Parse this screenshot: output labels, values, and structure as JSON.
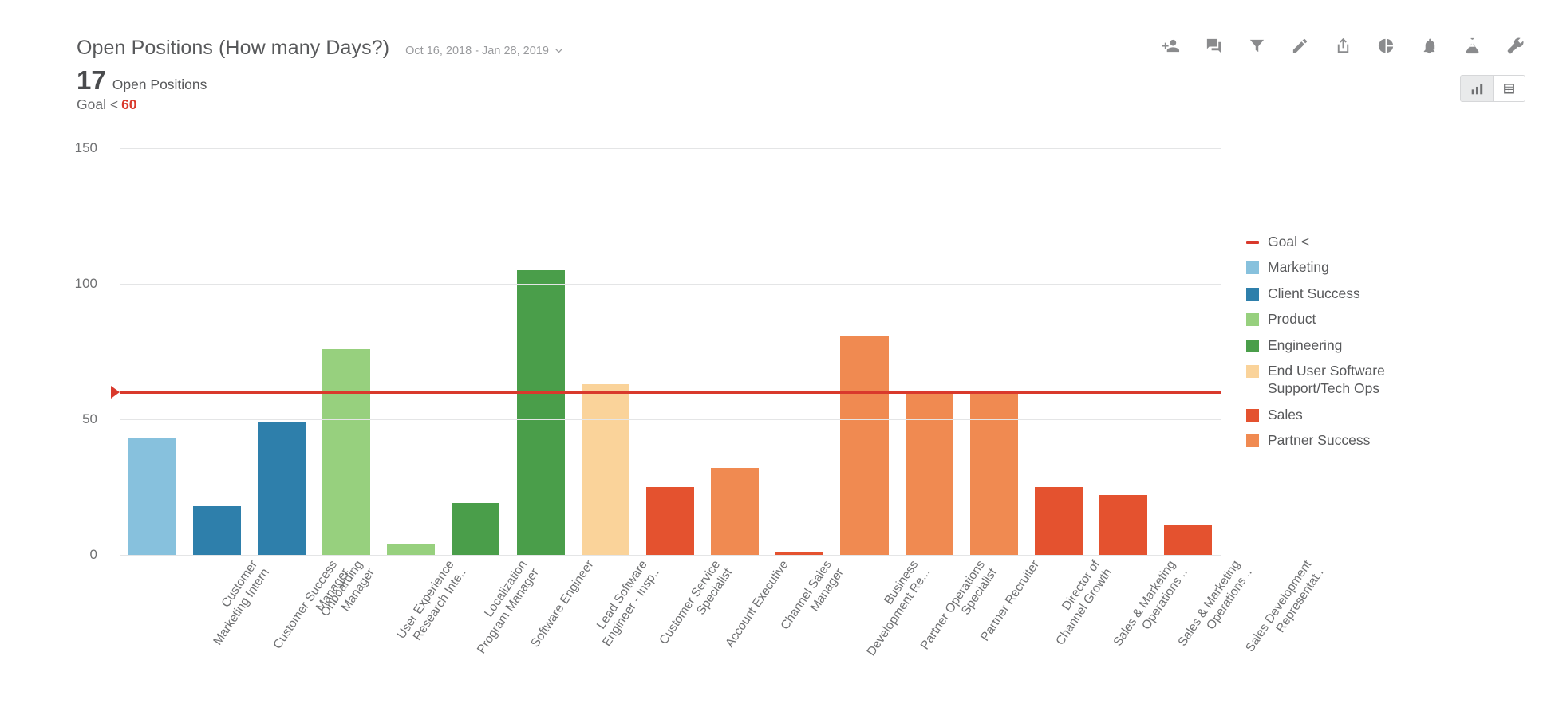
{
  "header": {
    "title": "Open Positions (How many Days?)",
    "date_range": "Oct 16, 2018 - Jan 28, 2019",
    "kpi_value": "17",
    "kpi_label": "Open Positions",
    "goal_label": "Goal <",
    "goal_value": "60"
  },
  "toolbar": {
    "items": [
      {
        "name": "add-person-icon",
        "label": "Add user"
      },
      {
        "name": "comment-icon",
        "label": "Comments"
      },
      {
        "name": "filter-icon",
        "label": "Filter"
      },
      {
        "name": "pencil-icon",
        "label": "Edit"
      },
      {
        "name": "share-icon",
        "label": "Share"
      },
      {
        "name": "pie-chart-icon",
        "label": "Chart type"
      },
      {
        "name": "bell-icon",
        "label": "Alerts"
      },
      {
        "name": "flask-icon",
        "label": "Experiment"
      },
      {
        "name": "wrench-icon",
        "label": "Settings"
      }
    ],
    "view_toggle": [
      {
        "name": "bar-chart-view",
        "label": "Chart view",
        "active": true
      },
      {
        "name": "table-view",
        "label": "Table view",
        "active": false
      }
    ]
  },
  "colors": {
    "goal": "#d9392c",
    "marketing": "#87c1dd",
    "client_success": "#2e7fab",
    "product": "#97d07e",
    "engineering": "#4a9e4a",
    "end_user_support": "#fad39a",
    "sales": "#e4522f",
    "partner_success": "#f08a51"
  },
  "chart_data": {
    "type": "bar",
    "title": "Open Positions (How many Days?)",
    "xlabel": "",
    "ylabel": "",
    "ylim": [
      0,
      150
    ],
    "yticks": [
      0,
      50,
      100,
      150
    ],
    "grid": true,
    "legend_position": "right",
    "goal": {
      "label": "Goal <",
      "value": 60,
      "color": "#d9392c"
    },
    "legend": [
      {
        "label": "Goal <",
        "color": "#d9392c",
        "type": "line"
      },
      {
        "label": "Marketing",
        "color": "#87c1dd",
        "type": "swatch"
      },
      {
        "label": "Client Success",
        "color": "#2e7fab",
        "type": "swatch"
      },
      {
        "label": "Product",
        "color": "#97d07e",
        "type": "swatch"
      },
      {
        "label": "Engineering",
        "color": "#4a9e4a",
        "type": "swatch"
      },
      {
        "label": "End User Software Support/Tech Ops",
        "color": "#fad39a",
        "type": "swatch"
      },
      {
        "label": "Sales",
        "color": "#e4522f",
        "type": "swatch"
      },
      {
        "label": "Partner Success",
        "color": "#f08a51",
        "type": "swatch"
      }
    ],
    "categories": [
      "Customer Marketing Intern",
      "Customer Success Manager",
      "Onboarding Manager",
      "User Experience Research Inte..",
      "Localization Program Manager",
      "Software Engineer",
      "Lead Software Engineer - Insp..",
      "Customer Service Specialist",
      "Account Executive",
      "Channel Sales Manager",
      "Business Development Re...",
      "Partner Operations Specialist",
      "Partner Recruiter",
      "Director of Channel Growth",
      "Sales & Marketing Operations ..",
      "Sales & Marketing Operations ..",
      "Sales Development Representat.."
    ],
    "category_lines": [
      [
        "Customer",
        "Marketing Intern"
      ],
      [
        "Customer Success",
        "Manager"
      ],
      [
        "Onboarding",
        "Manager"
      ],
      [
        "User Experience",
        "Research Inte.."
      ],
      [
        "Localization",
        "Program Manager"
      ],
      [
        "Software Engineer"
      ],
      [
        "Lead Software",
        "Engineer - Insp.."
      ],
      [
        "Customer Service",
        "Specialist"
      ],
      [
        "Account Executive"
      ],
      [
        "Channel Sales",
        "Manager"
      ],
      [
        "Business",
        "Development Re..."
      ],
      [
        "Partner Operations",
        "Specialist"
      ],
      [
        "Partner Recruiter"
      ],
      [
        "Director of",
        "Channel Growth"
      ],
      [
        "Sales & Marketing",
        "Operations .."
      ],
      [
        "Sales & Marketing",
        "Operations .."
      ],
      [
        "Sales Development",
        "Representat.."
      ]
    ],
    "values": [
      43,
      18,
      49,
      76,
      4,
      19,
      105,
      63,
      25,
      32,
      1,
      81,
      60,
      60,
      25,
      22,
      11
    ],
    "bar_colors": [
      "#87c1dd",
      "#2e7fab",
      "#2e7fab",
      "#97d07e",
      "#97d07e",
      "#4a9e4a",
      "#4a9e4a",
      "#fad39a",
      "#e4522f",
      "#f08a51",
      "#e4522f",
      "#f08a51",
      "#f08a51",
      "#f08a51",
      "#e4522f",
      "#e4522f",
      "#e4522f"
    ],
    "bar_series": [
      "Marketing",
      "Client Success",
      "Client Success",
      "Product",
      "Product",
      "Engineering",
      "Engineering",
      "End User Software Support/Tech Ops",
      "Sales",
      "Partner Success",
      "Sales",
      "Partner Success",
      "Partner Success",
      "Partner Success",
      "Sales",
      "Sales",
      "Sales"
    ]
  }
}
